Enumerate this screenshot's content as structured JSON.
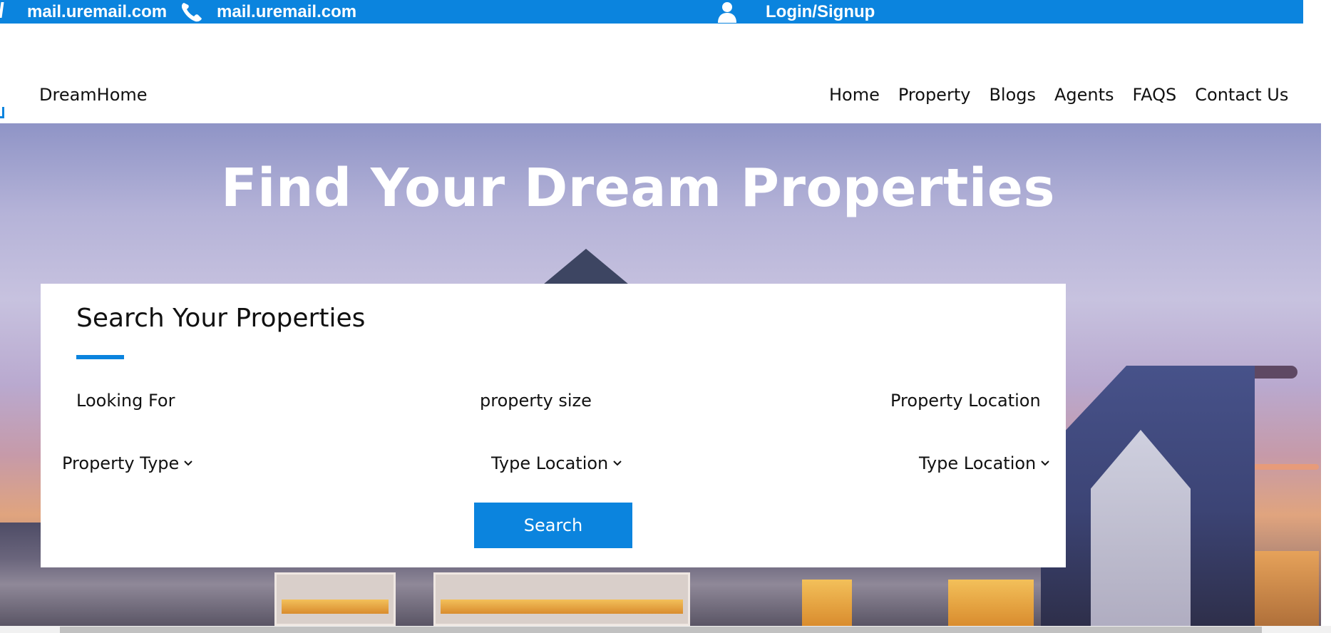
{
  "topbar": {
    "email_1": "mail.uremail.com",
    "email_2": "mail.uremail.com",
    "login_label": "Login/Signup",
    "phone_icon": "phone-icon",
    "user_icon": "user-icon"
  },
  "header": {
    "brand": "DreamHome",
    "nav": [
      "Home",
      "Property",
      "Blogs",
      "Agents",
      "FAQS",
      "Contact Us"
    ]
  },
  "hero": {
    "title": "Find Your Dream Properties"
  },
  "search": {
    "title": "Search Your Properties",
    "labels": [
      "Looking For",
      "property size",
      "Property Location"
    ],
    "selects": [
      "Property Type",
      "Type Location",
      "Type Location"
    ],
    "button_label": "Search",
    "chevron_icon": "chevron-down-icon"
  },
  "colors": {
    "accent": "#0b84de",
    "topbar_text": "#ffffff",
    "card_bg": "#ffffff"
  }
}
